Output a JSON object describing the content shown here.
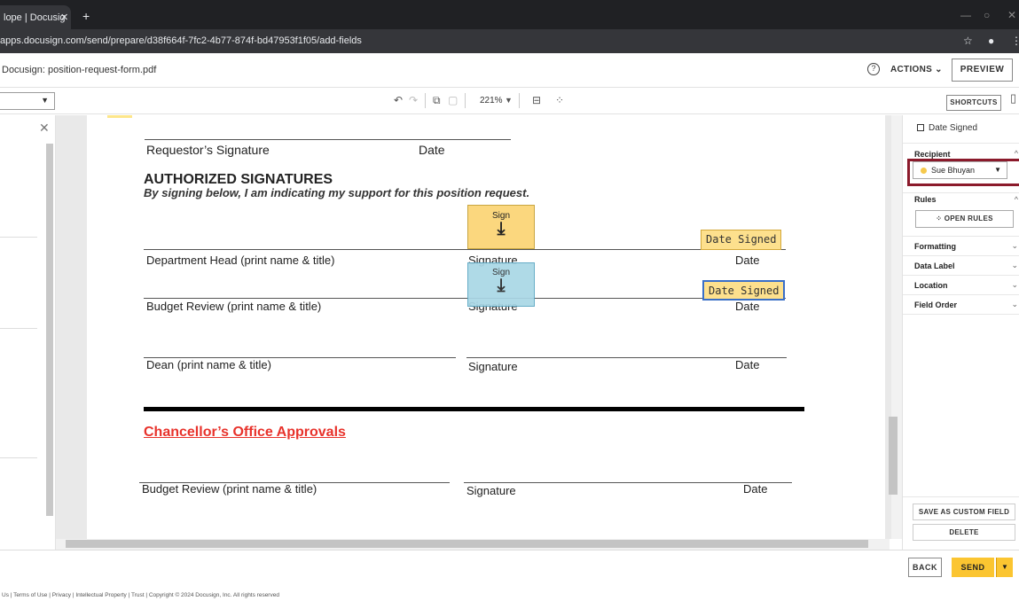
{
  "browser": {
    "tab_title": "lope | Docusig",
    "tab_close": "✕",
    "new_tab": "+",
    "url": "apps.docusign.com/send/prepare/d38f664f-7fc2-4b77-874f-bd47953f1f05/add-fields"
  },
  "header": {
    "doc_title": "Docusign: position-request-form.pdf",
    "help": "?",
    "actions_label": "ACTIONS ⌄",
    "preview_label": "PREVIEW"
  },
  "toolbar": {
    "zoom": "221%",
    "shortcuts_label": "SHORTCUTS"
  },
  "document": {
    "requestor_signature": "Requestor’s Signature",
    "requestor_date": "Date",
    "authorized_heading": "AUTHORIZED SIGNATURES",
    "authorized_sub": "By signing below, I am indicating my support for this position request.",
    "dept_head": "Department Head (print name & title)",
    "dept_signature": "Signature",
    "dept_date": "Date",
    "budget_review": "Budget Review (print name & title)",
    "budget_signature": "Signature",
    "budget_date": "Date",
    "dean": "Dean (print name & title)",
    "dean_signature": "Signature",
    "dean_date": "Date",
    "chancellor_heading": "Chancellor’s Office Approvals",
    "chancellor_budget": "Budget Review (print name & title)",
    "chancellor_signature": "Signature",
    "chancellor_date": "Date"
  },
  "tags": {
    "sign_label": "Sign",
    "date_signed": "Date Signed"
  },
  "right_panel": {
    "title": "Date Signed",
    "recipient_label": "Recipient",
    "recipient_name": "Sue Bhuyan",
    "rules_label": "Rules",
    "open_rules": "OPEN RULES",
    "formatting": "Formatting",
    "data_label": "Data Label",
    "location": "Location",
    "field_order": "Field Order",
    "save_custom": "SAVE AS CUSTOM FIELD",
    "delete": "DELETE"
  },
  "footer": {
    "back": "BACK",
    "send": "SEND",
    "legal": "Us   |   Terms of Use   |   Privacy   |   Intellectual Property   |   Trust   |   Copyright © 2024 Docusign, Inc. All rights reserved"
  },
  "colors": {
    "sign_tag_yellow": "#fbd77e",
    "sign_tag_blue": "#a9d7e6",
    "send_button": "#fbc531",
    "highlight": "#8b1a2b",
    "chancellor_heading": "#e8322b"
  }
}
